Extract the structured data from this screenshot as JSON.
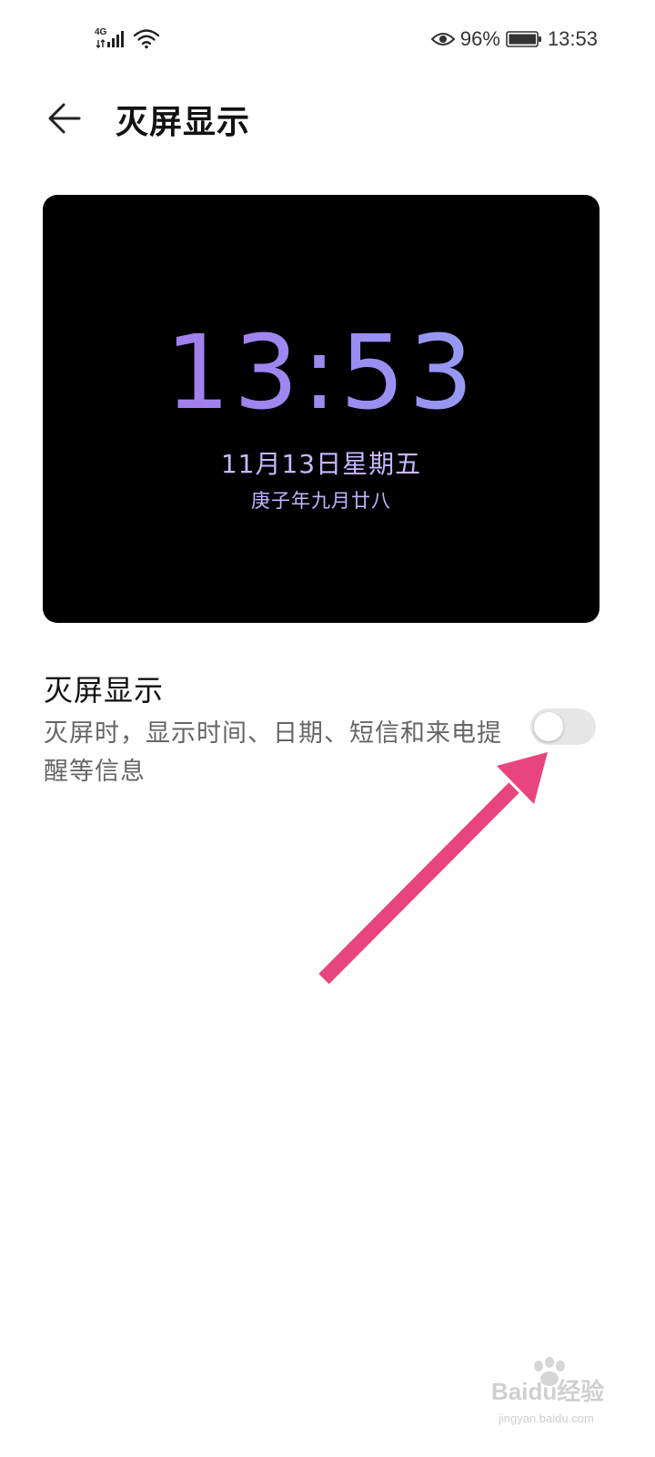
{
  "status_bar": {
    "network": "4G",
    "battery_percent": "96%",
    "clock": "13:53",
    "icons": [
      "signal-icon",
      "wifi-icon",
      "eye-comfort-icon",
      "battery-icon"
    ]
  },
  "header": {
    "title": "灭屏显示",
    "back_icon": "arrow-left-icon"
  },
  "preview": {
    "time": "13:53",
    "date": "11月13日星期五",
    "lunar_date": "庚子年九月廿八"
  },
  "setting": {
    "title": "灭屏显示",
    "description": "灭屏时，显示时间、日期、短信和来电提醒等信息",
    "toggle_on": false
  },
  "watermark": {
    "brand": "Baidu经验",
    "url": "jingyan.baidu.com"
  },
  "colors": {
    "annotation_arrow": "#e8447e",
    "toggle_off": "#e6e6e6",
    "preview_text": "#a98af0"
  }
}
